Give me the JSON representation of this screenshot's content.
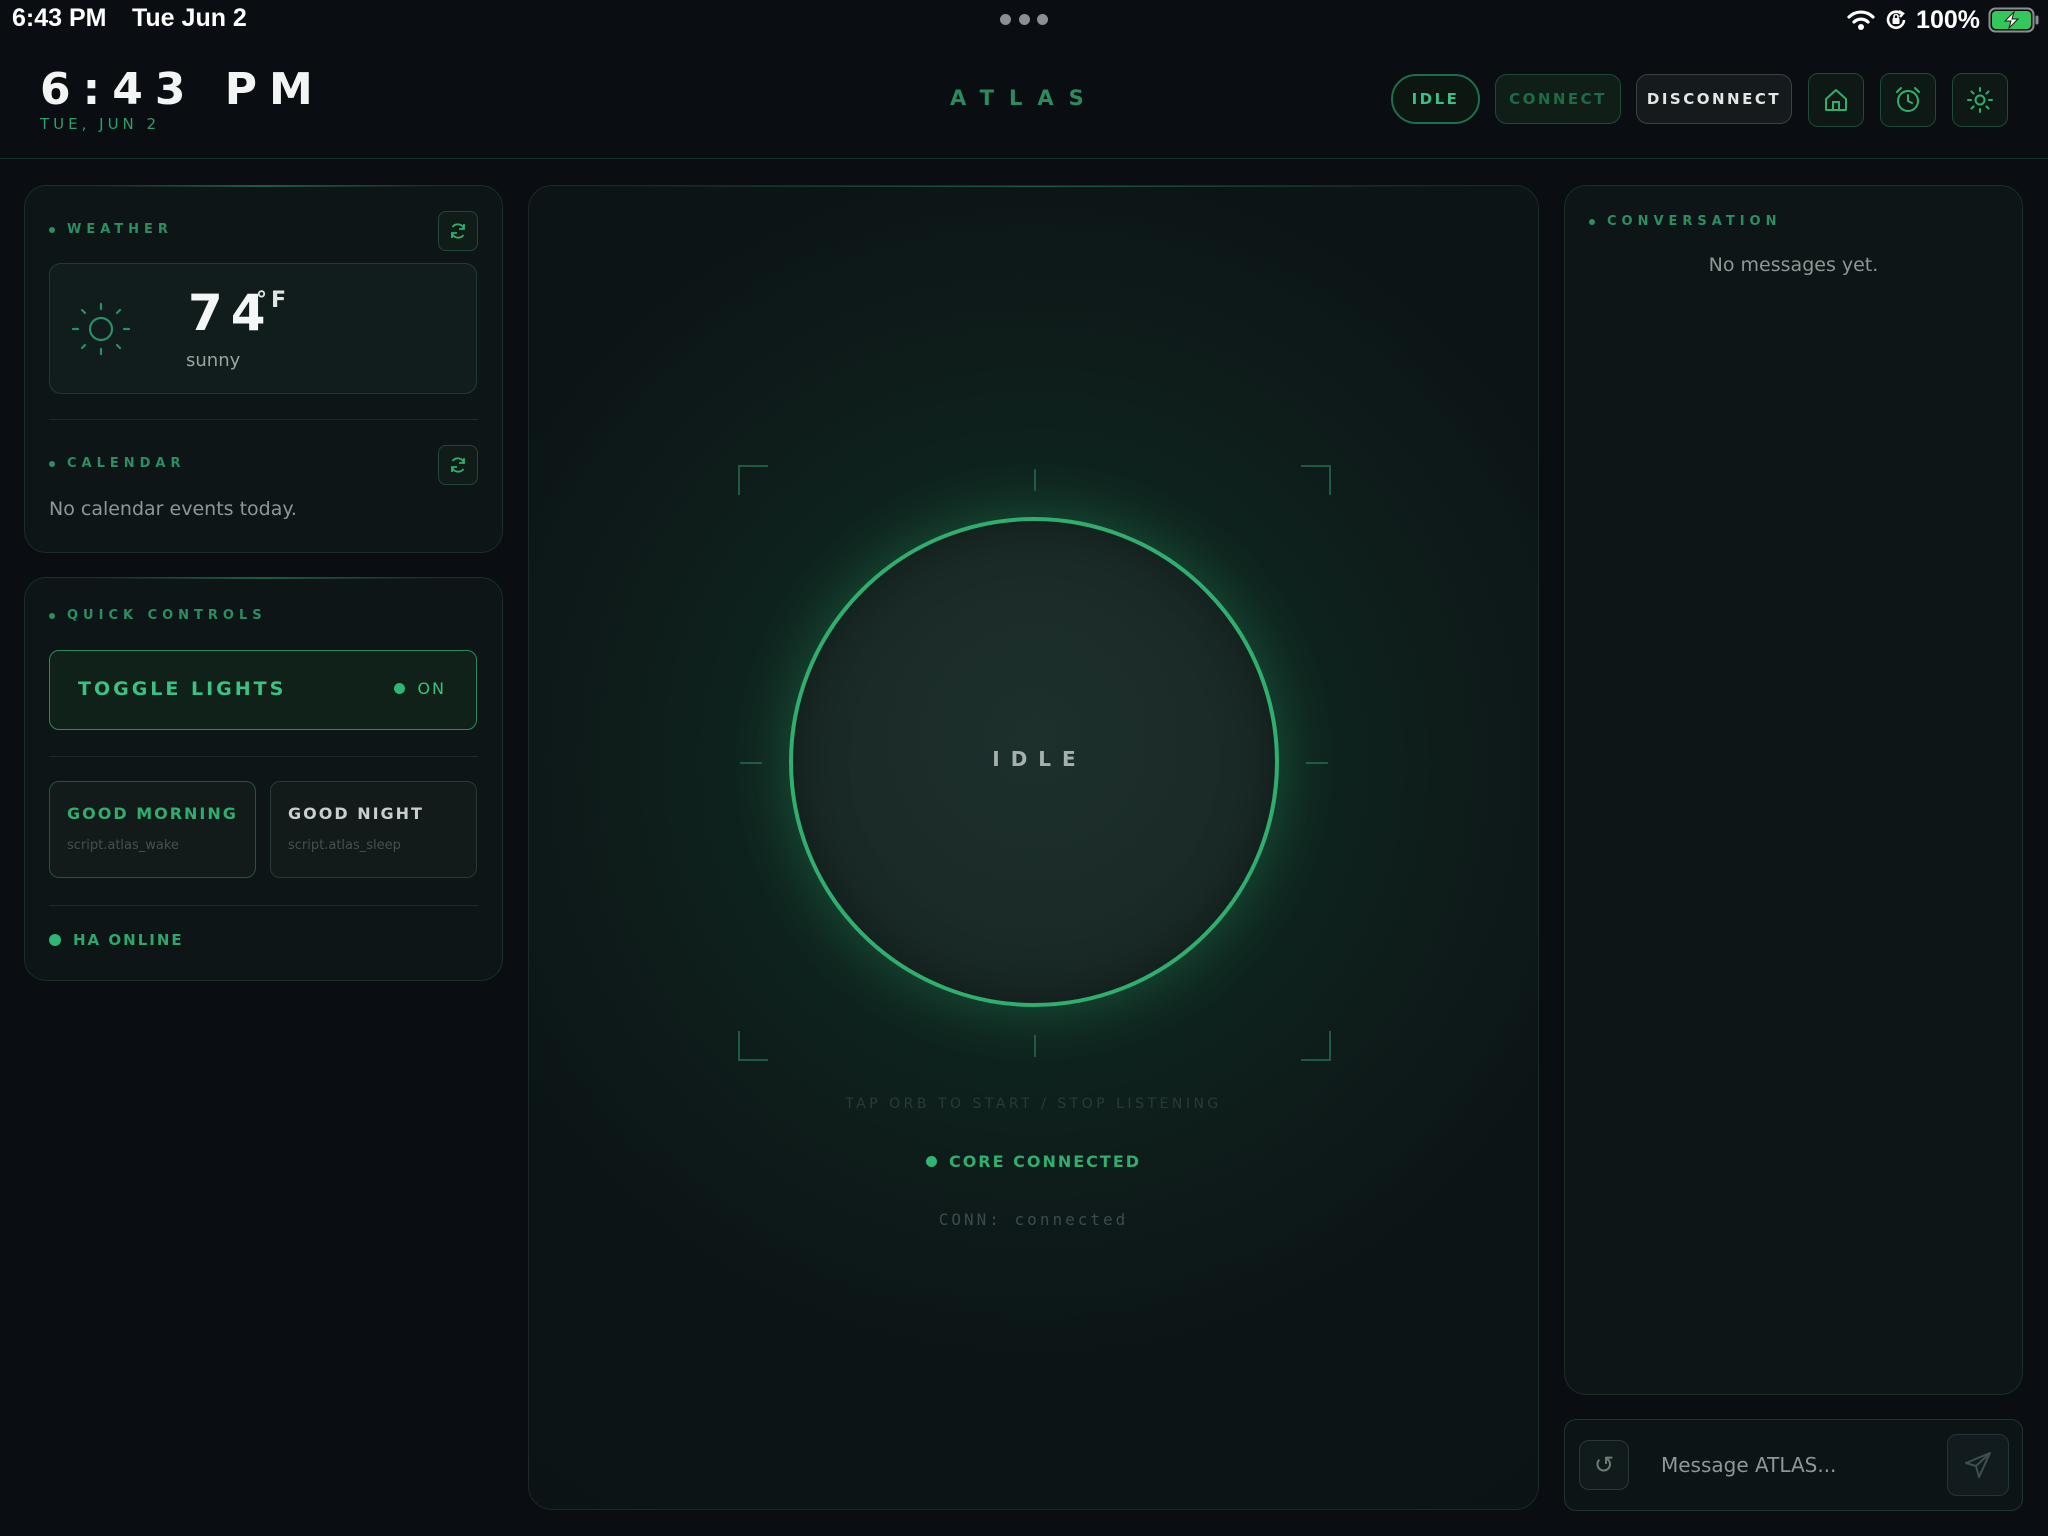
{
  "statusbar": {
    "time": "6:43 PM",
    "date": "Tue Jun 2",
    "battery": "100%",
    "icons": [
      "wifi-icon",
      "orientation-lock-icon",
      "battery-charging-icon"
    ]
  },
  "header": {
    "clock": "6:43 PM",
    "date": "TUE, JUN 2",
    "brand": "ATLAS",
    "state_pill": "IDLE",
    "connect_label": "CONNECT",
    "disconnect_label": "DISCONNECT",
    "icon_buttons": [
      "home-icon",
      "alarm-clock-icon",
      "settings-sun-icon"
    ]
  },
  "weather": {
    "label": "WEATHER",
    "temperature": "74",
    "unit": "°F",
    "condition": "sunny",
    "icon": "sun-icon"
  },
  "calendar": {
    "label": "CALENDAR",
    "empty_text": "No calendar events today."
  },
  "quick_controls": {
    "label": "QUICK CONTROLS",
    "toggle_label": "TOGGLE LIGHTS",
    "toggle_state": "ON",
    "scripts": [
      {
        "title": "GOOD MORNING",
        "entity": "script.atlas_wake"
      },
      {
        "title": "GOOD NIGHT",
        "entity": "script.atlas_sleep"
      }
    ],
    "ha_status": "HA ONLINE"
  },
  "center": {
    "orb_state": "IDLE",
    "hint": "TAP ORB TO START / STOP LISTENING",
    "core_status": "CORE CONNECTED",
    "conn_status": "CONN: connected"
  },
  "conversation": {
    "label": "CONVERSATION",
    "empty_text": "No messages yet.",
    "input_placeholder": "Message ATLAS...",
    "reset_glyph": "↺"
  },
  "colors": {
    "accent": "#2fae6e",
    "background": "#0a0e12",
    "panel": "#0e1517"
  }
}
